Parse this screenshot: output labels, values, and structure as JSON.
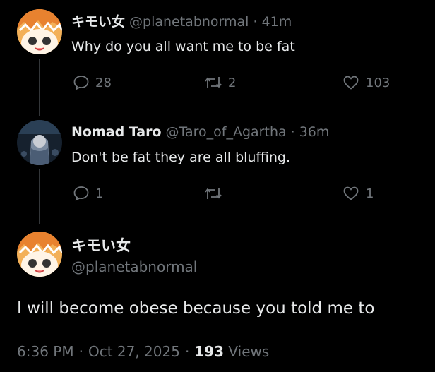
{
  "tweet1": {
    "name": "キモい女",
    "handle": "@planetabnormal",
    "sep": "·",
    "time": "41m",
    "text": "Why do you all want me to be fat",
    "replies": "28",
    "retweets": "2",
    "likes": "103"
  },
  "tweet2": {
    "name": "Nomad Taro",
    "handle": "@Taro_of_Agartha",
    "sep": "·",
    "time": "36m",
    "text": "Don't be fat they are all bluffing.",
    "replies": "1",
    "retweets": "",
    "likes": "1"
  },
  "main": {
    "name": "キモい女",
    "handle": "@planetabnormal",
    "text": "I will become obese because you told me to",
    "time": "6:36 PM",
    "sep1": "·",
    "date": "Oct 27, 2025",
    "sep2": "·",
    "views_count": "193",
    "views_label": "Views"
  },
  "icons": {
    "reply": "reply-icon",
    "retweet": "retweet-icon",
    "like": "like-icon"
  }
}
